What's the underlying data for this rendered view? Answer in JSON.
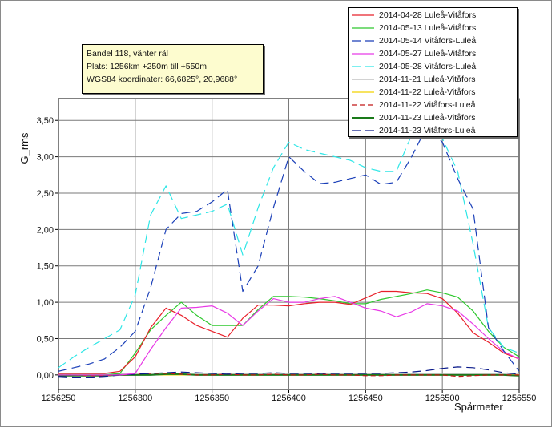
{
  "info": {
    "title": "Bandel 118, vänter räl",
    "position": "Plats: 1256km +250m till +550m",
    "coords": "WGS84 koordinater: 66,6825°, 20,9688°"
  },
  "chart_data": {
    "type": "line",
    "xlabel": "Spårmeter",
    "ylabel": "G_rms",
    "xlim": [
      1256250,
      1256550
    ],
    "ylim": [
      -0.2,
      3.8
    ],
    "x_ticks": [
      1256250,
      1256300,
      1256350,
      1256400,
      1256450,
      1256500,
      1256550
    ],
    "x_tick_labels": [
      "1256250",
      "1256300",
      "1256350",
      "1256400",
      "1256450",
      "1256500",
      "1256550"
    ],
    "y_ticks": [
      0,
      0.5,
      1,
      1.5,
      2,
      2.5,
      3,
      3.5
    ],
    "y_tick_labels": [
      "0,00",
      "0,50",
      "1,00",
      "1,50",
      "2,00",
      "2,50",
      "3,00",
      "3,50"
    ],
    "grid": true,
    "legend_position": "top-right",
    "x": [
      1256250,
      1256260,
      1256270,
      1256280,
      1256290,
      1256300,
      1256310,
      1256320,
      1256330,
      1256340,
      1256350,
      1256360,
      1256370,
      1256380,
      1256390,
      1256400,
      1256410,
      1256420,
      1256430,
      1256440,
      1256450,
      1256460,
      1256470,
      1256480,
      1256490,
      1256500,
      1256510,
      1256520,
      1256530,
      1256540,
      1256550
    ],
    "series": [
      {
        "name": "2014-04-28 Luleå-Vitåfors",
        "color": "#e8202a",
        "dash": "solid",
        "values": [
          0.02,
          0.02,
          0.02,
          0.02,
          0.05,
          0.25,
          0.65,
          0.92,
          0.82,
          0.68,
          0.6,
          0.52,
          0.78,
          0.96,
          0.96,
          0.95,
          0.98,
          1.0,
          1.0,
          0.97,
          1.06,
          1.15,
          1.15,
          1.13,
          1.12,
          1.05,
          0.85,
          0.58,
          0.45,
          0.3,
          0.22
        ]
      },
      {
        "name": "2014-05-13 Luleå-Vitåfors",
        "color": "#2ec82e",
        "dash": "solid",
        "values": [
          0.0,
          0.0,
          0.0,
          0.0,
          0.02,
          0.3,
          0.62,
          0.82,
          1.0,
          0.82,
          0.68,
          0.68,
          0.68,
          0.9,
          1.08,
          1.08,
          1.07,
          1.05,
          1.02,
          0.98,
          0.98,
          1.04,
          1.08,
          1.12,
          1.17,
          1.13,
          1.07,
          0.88,
          0.6,
          0.38,
          0.25
        ]
      },
      {
        "name": "2014-05-14 Vitåfors-Luleå",
        "color": "#1a3fb8",
        "dash": "long",
        "values": [
          0.05,
          0.1,
          0.15,
          0.22,
          0.38,
          0.6,
          1.2,
          2.0,
          2.22,
          2.25,
          2.38,
          2.55,
          1.15,
          1.5,
          2.3,
          3.0,
          2.8,
          2.63,
          2.65,
          2.7,
          2.75,
          2.62,
          2.65,
          3.0,
          3.42,
          3.2,
          2.7,
          2.28,
          0.65,
          0.33,
          0.05
        ]
      },
      {
        "name": "2014-05-27 Luleå-Vitåfors",
        "color": "#e83ae6",
        "dash": "solid",
        "values": [
          0.0,
          0.0,
          0.0,
          0.0,
          0.0,
          0.02,
          0.35,
          0.65,
          0.92,
          0.93,
          0.95,
          0.85,
          0.68,
          0.88,
          1.05,
          1.0,
          1.0,
          1.05,
          1.08,
          1.0,
          0.92,
          0.88,
          0.8,
          0.87,
          0.98,
          0.95,
          0.88,
          0.7,
          0.5,
          0.32,
          0.22
        ]
      },
      {
        "name": "2014-05-28 Vitåfors-Luleå",
        "color": "#2ee6e6",
        "dash": "long",
        "values": [
          0.1,
          0.25,
          0.38,
          0.5,
          0.62,
          1.1,
          2.2,
          2.6,
          2.15,
          2.2,
          2.25,
          2.35,
          1.65,
          2.3,
          2.85,
          3.2,
          3.1,
          3.05,
          3.0,
          2.95,
          2.85,
          2.8,
          2.8,
          3.3,
          3.55,
          3.25,
          2.8,
          1.8,
          0.65,
          0.38,
          0.3
        ]
      },
      {
        "name": "2014-11-21 Luleå-Vitåfors",
        "color": "#b8b8b8",
        "dash": "solid",
        "values": [
          0.01,
          0.01,
          0.01,
          0.01,
          0.01,
          0.01,
          0.01,
          0.01,
          0.01,
          0.01,
          0.01,
          0.01,
          0.01,
          0.01,
          0.01,
          0.01,
          0.01,
          0.01,
          0.01,
          0.01,
          0.01,
          0.01,
          0.01,
          0.01,
          0.01,
          0.01,
          0.01,
          0.01,
          0.01,
          0.01,
          0.01
        ]
      },
      {
        "name": "2014-11-22 Luleå-Vitåfors",
        "color": "#f2d200",
        "dash": "solid",
        "values": [
          0.0,
          0.0,
          0.0,
          0.0,
          0.0,
          0.0,
          0.0,
          0.0,
          0.0,
          0.0,
          0.0,
          0.0,
          0.0,
          0.0,
          0.0,
          0.0,
          0.0,
          0.0,
          0.0,
          0.0,
          0.0,
          0.0,
          0.0,
          0.0,
          0.0,
          0.0,
          0.0,
          0.0,
          0.0,
          0.0,
          0.0
        ]
      },
      {
        "name": "2014-11-22 Vitåfors-Luleå",
        "color": "#c21818",
        "dash": "short",
        "values": [
          0.0,
          0.0,
          -0.01,
          -0.01,
          0.0,
          0.01,
          0.02,
          0.02,
          0.01,
          0.0,
          0.0,
          0.01,
          0.0,
          0.0,
          0.01,
          0.0,
          0.0,
          0.01,
          0.0,
          0.0,
          -0.01,
          -0.01,
          0.0,
          0.0,
          0.0,
          0.0,
          -0.02,
          -0.01,
          0.0,
          0.0,
          0.0
        ]
      },
      {
        "name": "2014-11-23 Luleå-Vitåfors",
        "color": "#1a7a1a",
        "dash": "solid",
        "values": [
          -0.01,
          -0.01,
          -0.01,
          -0.01,
          0.0,
          0.0,
          0.0,
          0.01,
          0.01,
          0.0,
          0.0,
          0.0,
          0.0,
          0.0,
          0.0,
          0.0,
          0.0,
          0.0,
          0.0,
          0.0,
          0.0,
          0.0,
          0.0,
          0.0,
          0.0,
          0.0,
          0.0,
          0.0,
          0.0,
          0.0,
          -0.01
        ]
      },
      {
        "name": "2014-11-23 Vitåfors-Luleå",
        "color": "#0a1a8a",
        "dash": "long",
        "values": [
          -0.02,
          -0.03,
          -0.03,
          -0.02,
          0.0,
          0.01,
          0.02,
          0.03,
          0.04,
          0.03,
          0.02,
          0.01,
          0.02,
          0.02,
          0.03,
          0.02,
          0.02,
          0.02,
          0.02,
          0.02,
          0.02,
          0.02,
          0.03,
          0.04,
          0.06,
          0.09,
          0.11,
          0.1,
          0.07,
          0.03,
          0.01
        ]
      }
    ]
  }
}
